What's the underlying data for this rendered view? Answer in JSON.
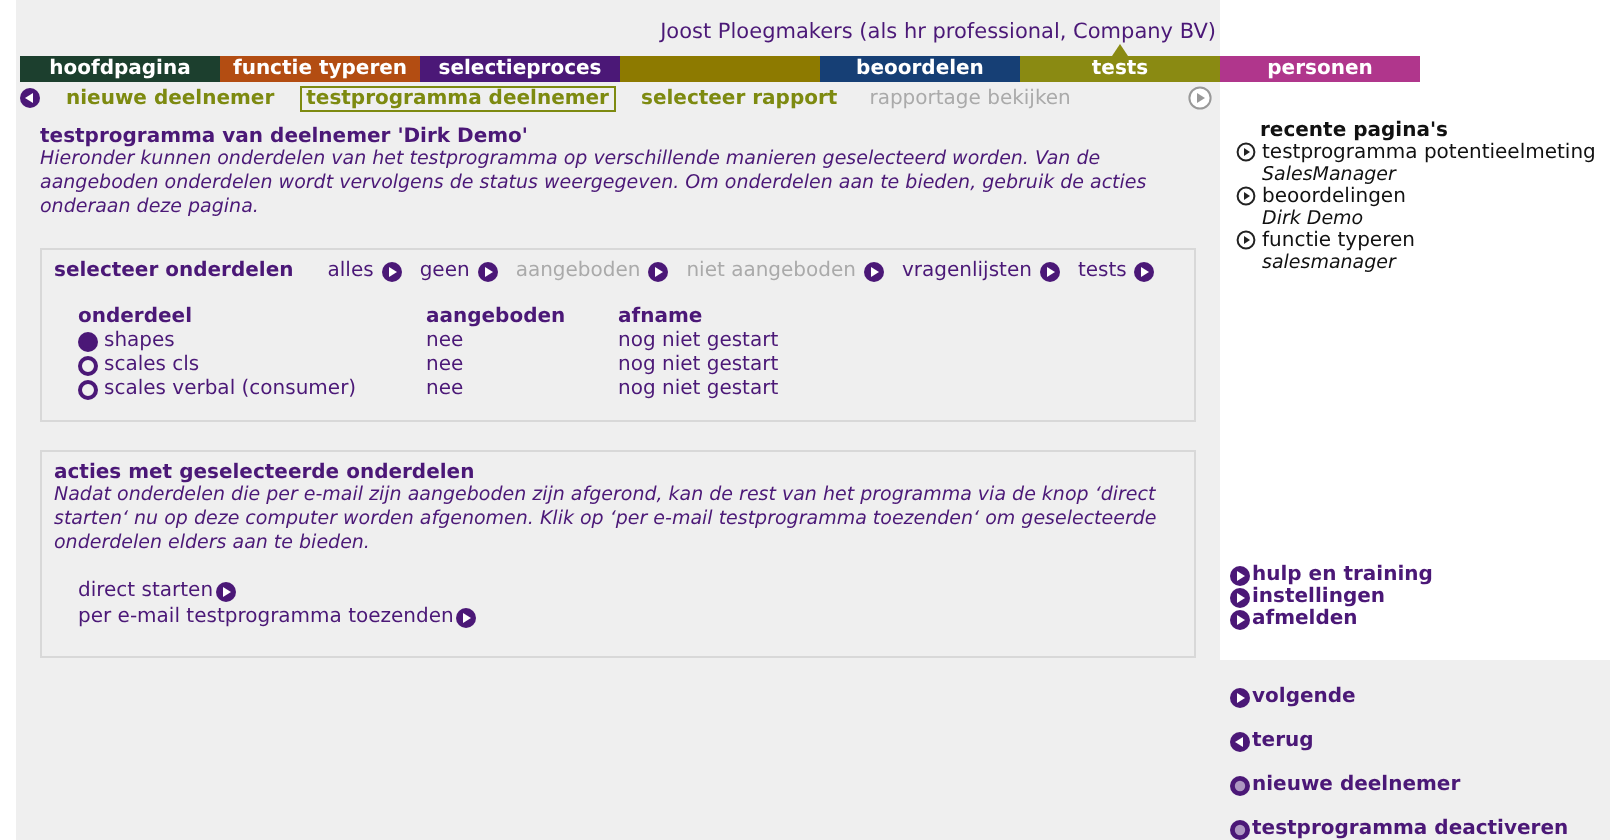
{
  "user": "Joost Ploegmakers (als hr professional, Company BV)",
  "tabs": [
    {
      "label": "hoofdpagina",
      "color": "#1c3f2e",
      "selected": false
    },
    {
      "label": "functie typeren",
      "color": "#b34d12",
      "selected": false
    },
    {
      "label": "selectieproces",
      "color": "#4b1877",
      "selected": false
    },
    {
      "color": "#8d7a00",
      "selected": false
    },
    {
      "label": "beoordelen",
      "color": "#163f75",
      "selected": false
    },
    {
      "label": "tests",
      "color": "#8a8a12",
      "selected": true
    },
    {
      "label": "personen",
      "color": "#b0368c",
      "selected": false
    }
  ],
  "subnav": [
    {
      "label": "nieuwe deelnemer",
      "selected": false,
      "disabled": false
    },
    {
      "label": "testprogramma deelnemer",
      "selected": true,
      "disabled": false
    },
    {
      "label": "selecteer rapport",
      "selected": false,
      "disabled": false
    },
    {
      "label": "rapportage bekijken",
      "selected": false,
      "disabled": true
    }
  ],
  "main": {
    "title": "testprogramma van deelnemer 'Dirk Demo'",
    "intro": "Hieronder kunnen onderdelen van het testprogramma op verschillende manieren geselecteerd worden. Van de aangeboden onderdelen wordt vervolgens de status weergegeven. Om onderdelen aan te bieden, gebruik de acties onderaan deze pagina.",
    "select": {
      "label": "selecteer onderdelen",
      "options": [
        {
          "label": "alles",
          "disabled": false
        },
        {
          "label": "geen",
          "disabled": false
        },
        {
          "label": "aangeboden",
          "disabled": true
        },
        {
          "label": "niet aangeboden",
          "disabled": true
        },
        {
          "label": "vragenlijsten",
          "disabled": false
        },
        {
          "label": "tests",
          "disabled": false
        }
      ]
    },
    "table": {
      "columns": [
        "onderdeel",
        "aangeboden",
        "afname"
      ],
      "rows": [
        {
          "name": "shapes",
          "offered": "nee",
          "status": "nog niet gestart",
          "selected": true
        },
        {
          "name": "scales cls",
          "offered": "nee",
          "status": "nog niet gestart",
          "selected": false
        },
        {
          "name": "scales verbal (consumer)",
          "offered": "nee",
          "status": "nog niet gestart",
          "selected": false
        }
      ]
    },
    "actions": {
      "title": "acties met geselecteerde onderdelen",
      "text": "Nadat onderdelen die per e-mail zijn aangeboden zijn afgerond, kan de rest van het programma via de knop ‘direct starten‘ nu op deze computer worden afgenomen. Klik op ‘per e-mail testprogramma toezenden‘ om geselecteerde onderdelen elders aan te bieden.",
      "links": [
        "direct starten",
        "per e-mail testprogramma toezenden"
      ]
    }
  },
  "recent": {
    "title": "recente pagina's",
    "items": [
      {
        "label": "testprogramma potentieelmeting",
        "sub": "SalesManager"
      },
      {
        "label": "beoordelingen",
        "sub": "Dirk Demo"
      },
      {
        "label": "functie typeren",
        "sub": "salesmanager"
      }
    ]
  },
  "menu": [
    "hulp en training",
    "instellingen",
    "afmelden"
  ],
  "nav": [
    {
      "label": "volgende",
      "kind": "next"
    },
    {
      "label": "terug",
      "kind": "back"
    },
    {
      "label": "nieuwe deelnemer",
      "kind": "new"
    },
    {
      "label": "testprogramma deactiveren",
      "kind": "stop"
    }
  ]
}
